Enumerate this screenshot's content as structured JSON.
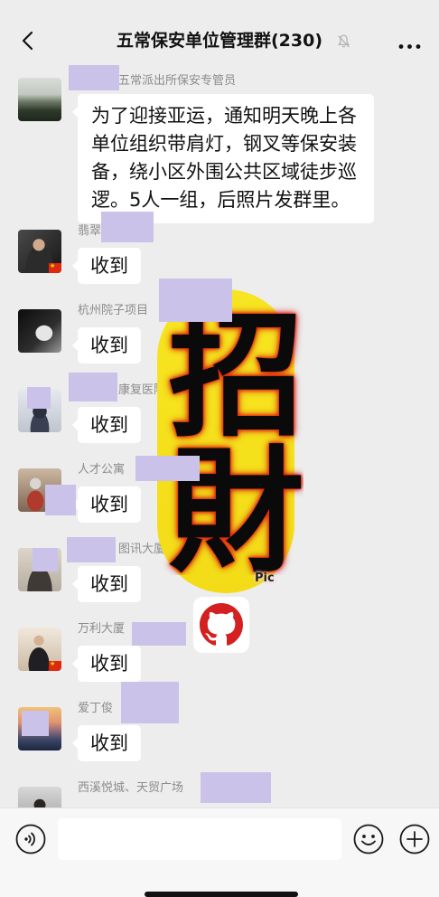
{
  "header": {
    "title": "五常保安单位管理群(230)",
    "back_icon": "chevron-left-icon",
    "mute_icon": "bell-off-icon",
    "more_icon": "more-dots-icon"
  },
  "messages": [
    {
      "sender": "五常派出所保安专管员",
      "text": "为了迎接亚运，通知明天晚上各单位组织带肩灯，钢叉等保安装备，绕小区外围公共区域徒步巡逻。5人一组，后照片发群里。"
    },
    {
      "sender": "翡翠",
      "text": "收到",
      "badge_icon": "china-flag-icon"
    },
    {
      "sender": "杭州院子项目",
      "text": "收到"
    },
    {
      "sender": "康复医院",
      "text": "收到"
    },
    {
      "sender": "人才公寓",
      "text": "收到"
    },
    {
      "sender": "图讯大厦",
      "text": "收到"
    },
    {
      "sender": "万利大厦",
      "text": "收到",
      "badge_icon": "china-flag-icon"
    },
    {
      "sender": "爱丁俊",
      "text": "收到"
    },
    {
      "sender": "西溪悦城、天贸广场"
    }
  ],
  "watermark": {
    "text": "招財",
    "caption": "Pic",
    "logo_icon": "github-icon"
  },
  "input_bar": {
    "value": "",
    "voice_icon": "voice-icon",
    "emoji_icon": "emoji-icon",
    "plus_icon": "plus-icon"
  },
  "colors": {
    "background": "#ededed",
    "bubble": "#ffffff",
    "redaction": "#cbc2e9",
    "watermark_yellow": "#f5e11c",
    "logo_red": "#d42020"
  }
}
